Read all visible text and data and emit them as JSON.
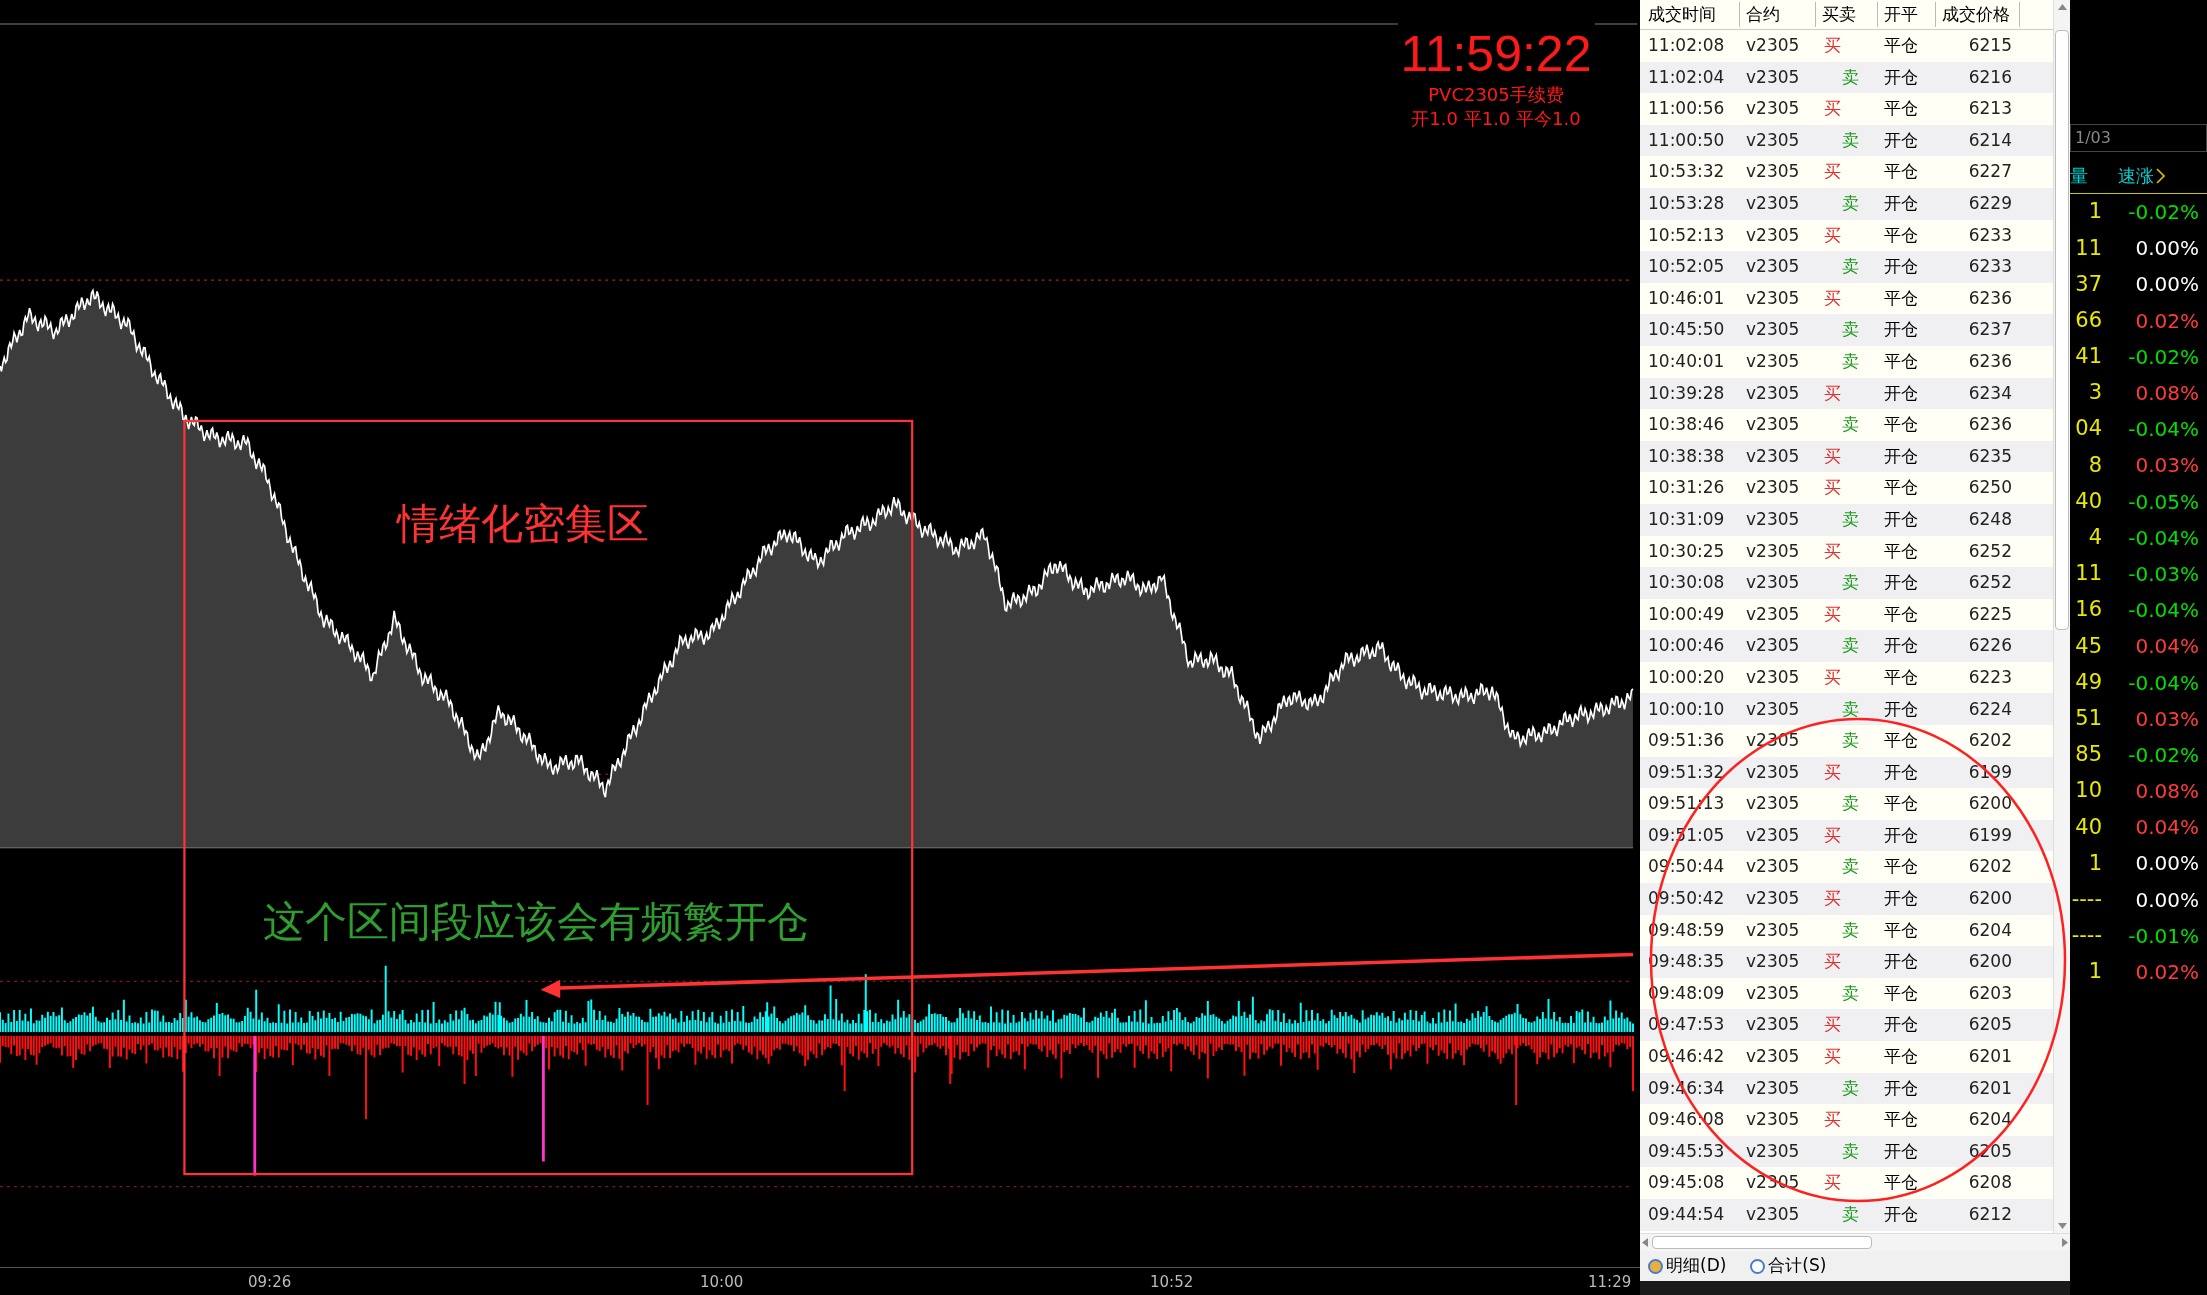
{
  "clock": {
    "time": "11:59:22",
    "fee_title": "PVC2305手续费",
    "fee_detail": "开1.0 平1.0 平今1.0"
  },
  "annotation_labels": [
    {
      "text": "情绪化密集区",
      "color": "#ff3333"
    },
    {
      "text": "这个区间段应该会有频繁开仓",
      "color": "#2e9e2e"
    }
  ],
  "time_axis": [
    "09:26",
    "10:00",
    "10:52",
    "11:29"
  ],
  "trades": {
    "columns": [
      "成交时间",
      "合约",
      "买卖",
      "开平",
      "成交价格"
    ],
    "rows": [
      {
        "time": "11:02:08",
        "contract": "v2305",
        "side": "买",
        "kind": "buy",
        "action": "平仓",
        "price": "6215"
      },
      {
        "time": "11:02:04",
        "contract": "v2305",
        "side": "卖",
        "kind": "sell",
        "action": "开仓",
        "price": "6216"
      },
      {
        "time": "11:00:56",
        "contract": "v2305",
        "side": "买",
        "kind": "buy",
        "action": "平仓",
        "price": "6213"
      },
      {
        "time": "11:00:50",
        "contract": "v2305",
        "side": "卖",
        "kind": "sell",
        "action": "开仓",
        "price": "6214"
      },
      {
        "time": "10:53:32",
        "contract": "v2305",
        "side": "买",
        "kind": "buy",
        "action": "平仓",
        "price": "6227"
      },
      {
        "time": "10:53:28",
        "contract": "v2305",
        "side": "卖",
        "kind": "sell",
        "action": "开仓",
        "price": "6229"
      },
      {
        "time": "10:52:13",
        "contract": "v2305",
        "side": "买",
        "kind": "buy",
        "action": "平仓",
        "price": "6233"
      },
      {
        "time": "10:52:05",
        "contract": "v2305",
        "side": "卖",
        "kind": "sell",
        "action": "开仓",
        "price": "6233"
      },
      {
        "time": "10:46:01",
        "contract": "v2305",
        "side": "买",
        "kind": "buy",
        "action": "平仓",
        "price": "6236"
      },
      {
        "time": "10:45:50",
        "contract": "v2305",
        "side": "卖",
        "kind": "sell",
        "action": "开仓",
        "price": "6237"
      },
      {
        "time": "10:40:01",
        "contract": "v2305",
        "side": "卖",
        "kind": "sell",
        "action": "平仓",
        "price": "6236"
      },
      {
        "time": "10:39:28",
        "contract": "v2305",
        "side": "买",
        "kind": "buy",
        "action": "开仓",
        "price": "6234"
      },
      {
        "time": "10:38:46",
        "contract": "v2305",
        "side": "卖",
        "kind": "sell",
        "action": "平仓",
        "price": "6236"
      },
      {
        "time": "10:38:38",
        "contract": "v2305",
        "side": "买",
        "kind": "buy",
        "action": "开仓",
        "price": "6235"
      },
      {
        "time": "10:31:26",
        "contract": "v2305",
        "side": "买",
        "kind": "buy",
        "action": "平仓",
        "price": "6250"
      },
      {
        "time": "10:31:09",
        "contract": "v2305",
        "side": "卖",
        "kind": "sell",
        "action": "开仓",
        "price": "6248"
      },
      {
        "time": "10:30:25",
        "contract": "v2305",
        "side": "买",
        "kind": "buy",
        "action": "平仓",
        "price": "6252"
      },
      {
        "time": "10:30:08",
        "contract": "v2305",
        "side": "卖",
        "kind": "sell",
        "action": "开仓",
        "price": "6252"
      },
      {
        "time": "10:00:49",
        "contract": "v2305",
        "side": "买",
        "kind": "buy",
        "action": "平仓",
        "price": "6225"
      },
      {
        "time": "10:00:46",
        "contract": "v2305",
        "side": "卖",
        "kind": "sell",
        "action": "开仓",
        "price": "6226"
      },
      {
        "time": "10:00:20",
        "contract": "v2305",
        "side": "买",
        "kind": "buy",
        "action": "平仓",
        "price": "6223"
      },
      {
        "time": "10:00:10",
        "contract": "v2305",
        "side": "卖",
        "kind": "sell",
        "action": "开仓",
        "price": "6224"
      },
      {
        "time": "09:51:36",
        "contract": "v2305",
        "side": "卖",
        "kind": "sell",
        "action": "平仓",
        "price": "6202"
      },
      {
        "time": "09:51:32",
        "contract": "v2305",
        "side": "买",
        "kind": "buy",
        "action": "开仓",
        "price": "6199"
      },
      {
        "time": "09:51:13",
        "contract": "v2305",
        "side": "卖",
        "kind": "sell",
        "action": "平仓",
        "price": "6200"
      },
      {
        "time": "09:51:05",
        "contract": "v2305",
        "side": "买",
        "kind": "buy",
        "action": "开仓",
        "price": "6199"
      },
      {
        "time": "09:50:44",
        "contract": "v2305",
        "side": "卖",
        "kind": "sell",
        "action": "平仓",
        "price": "6202"
      },
      {
        "time": "09:50:42",
        "contract": "v2305",
        "side": "买",
        "kind": "buy",
        "action": "开仓",
        "price": "6200"
      },
      {
        "time": "09:48:59",
        "contract": "v2305",
        "side": "卖",
        "kind": "sell",
        "action": "平仓",
        "price": "6204"
      },
      {
        "time": "09:48:35",
        "contract": "v2305",
        "side": "买",
        "kind": "buy",
        "action": "开仓",
        "price": "6200"
      },
      {
        "time": "09:48:09",
        "contract": "v2305",
        "side": "卖",
        "kind": "sell",
        "action": "平仓",
        "price": "6203"
      },
      {
        "time": "09:47:53",
        "contract": "v2305",
        "side": "买",
        "kind": "buy",
        "action": "开仓",
        "price": "6205"
      },
      {
        "time": "09:46:42",
        "contract": "v2305",
        "side": "买",
        "kind": "buy",
        "action": "平仓",
        "price": "6201"
      },
      {
        "time": "09:46:34",
        "contract": "v2305",
        "side": "卖",
        "kind": "sell",
        "action": "开仓",
        "price": "6201"
      },
      {
        "time": "09:46:08",
        "contract": "v2305",
        "side": "买",
        "kind": "buy",
        "action": "平仓",
        "price": "6204"
      },
      {
        "time": "09:45:53",
        "contract": "v2305",
        "side": "卖",
        "kind": "sell",
        "action": "开仓",
        "price": "6205"
      },
      {
        "time": "09:45:08",
        "contract": "v2305",
        "side": "买",
        "kind": "buy",
        "action": "平仓",
        "price": "6208"
      },
      {
        "time": "09:44:54",
        "contract": "v2305",
        "side": "卖",
        "kind": "sell",
        "action": "开仓",
        "price": "6212"
      }
    ]
  },
  "view_options": [
    {
      "label": "明细(D)",
      "selected": true
    },
    {
      "label": "合计(S)",
      "selected": false
    }
  ],
  "side_panel": {
    "date": "1/03",
    "columns": [
      "量",
      "速涨"
    ],
    "rows": [
      {
        "volume": "1",
        "change": "-0.02%",
        "color": "#00e000"
      },
      {
        "volume": "11",
        "change": "0.00%",
        "color": "#ffffff"
      },
      {
        "volume": "37",
        "change": "0.00%",
        "color": "#ffffff"
      },
      {
        "volume": "66",
        "change": "0.02%",
        "color": "#ff3c3c"
      },
      {
        "volume": "41",
        "change": "-0.02%",
        "color": "#00e000"
      },
      {
        "volume": "3",
        "change": "0.08%",
        "color": "#ff3c3c"
      },
      {
        "volume": "04",
        "change": "-0.04%",
        "color": "#00e000"
      },
      {
        "volume": "8",
        "change": "0.03%",
        "color": "#ff3c3c"
      },
      {
        "volume": "40",
        "change": "-0.05%",
        "color": "#00e000"
      },
      {
        "volume": "4",
        "change": "-0.04%",
        "color": "#00e000"
      },
      {
        "volume": "11",
        "change": "-0.03%",
        "color": "#00e000"
      },
      {
        "volume": "16",
        "change": "-0.04%",
        "color": "#00e000"
      },
      {
        "volume": "45",
        "change": "0.04%",
        "color": "#ff3c3c"
      },
      {
        "volume": "49",
        "change": "-0.04%",
        "color": "#00e000"
      },
      {
        "volume": "51",
        "change": "0.03%",
        "color": "#ff3c3c"
      },
      {
        "volume": "85",
        "change": "-0.02%",
        "color": "#00e000"
      },
      {
        "volume": "10",
        "change": "0.08%",
        "color": "#ff3c3c"
      },
      {
        "volume": "40",
        "change": "0.04%",
        "color": "#ff3c3c"
      },
      {
        "volume": "1",
        "change": "0.00%",
        "color": "#ffffff"
      },
      {
        "volume": "----",
        "change": "0.00%",
        "color": "#ffffff"
      },
      {
        "volume": "----",
        "change": "-0.01%",
        "color": "#00e000"
      },
      {
        "volume": "1",
        "change": "0.02%",
        "color": "#ff3c3c"
      }
    ]
  }
}
